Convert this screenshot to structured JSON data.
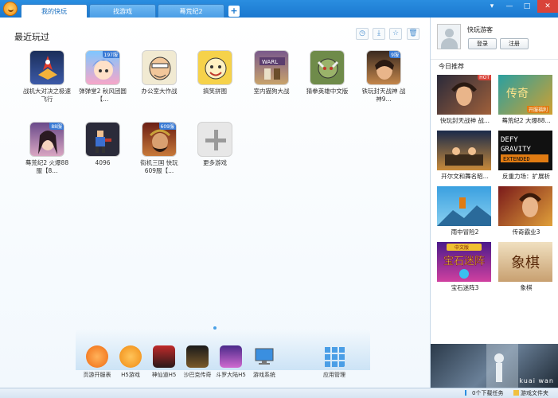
{
  "tabs": [
    {
      "label": "我的快玩",
      "active": true
    },
    {
      "label": "找游戏",
      "active": false
    },
    {
      "label": "蓦荒纪2",
      "active": false
    }
  ],
  "tab_add_label": "+",
  "window_controls": {
    "menu": "▾",
    "minimize": "—",
    "maximize": "□",
    "close": "✕"
  },
  "main": {
    "section_title": "最近玩过",
    "tools": [
      "clock-icon",
      "download-icon",
      "star-icon",
      "trash-icon"
    ],
    "games": [
      {
        "name": "战机大对决之极速飞行",
        "badge": ""
      },
      {
        "name": "弹弹堂2 秋风团圆【...",
        "badge": "197服"
      },
      {
        "name": "办公室大作战",
        "badge": ""
      },
      {
        "name": "搞笑拼图",
        "badge": ""
      },
      {
        "name": "室内猫狗大战",
        "badge": ""
      },
      {
        "name": "猜拳英雄中文版",
        "badge": ""
      },
      {
        "name": "铁玩封天战神 战神9...",
        "badge": "9服"
      },
      {
        "name": "蓦荒纪2 火爆88服【8...",
        "badge": "88服"
      },
      {
        "name": "4096",
        "badge": ""
      },
      {
        "name": "街机三国 快玩609服【...",
        "badge": "609服"
      },
      {
        "name": "更多游戏",
        "badge": ""
      }
    ]
  },
  "dock": [
    {
      "label": "页游开服表"
    },
    {
      "label": "H5游戏"
    },
    {
      "label": "神仙道H5"
    },
    {
      "label": "沙巴克传奇"
    },
    {
      "label": "斗罗大陆H5"
    },
    {
      "label": "游戏系统"
    },
    {
      "label": "应用管理"
    }
  ],
  "sidebar": {
    "username": "快玩游客",
    "login_label": "登录",
    "register_label": "注册",
    "today_title": "今日推荐",
    "recommend": [
      {
        "name": "快玩封天战神 战..."
      },
      {
        "name": "蓦荒纪2 大爆88..."
      },
      {
        "name": "开尔文和舞名昭..."
      },
      {
        "name": "反重力场：扩展析"
      },
      {
        "name": "雨中冒险2"
      },
      {
        "name": "传奇霸业3"
      },
      {
        "name": "宝石迷阵3"
      },
      {
        "name": "象棋"
      }
    ],
    "banner_text": "kuai wan",
    "recommend_text": {
      "defy": "DEFY",
      "gravity": "GRAVITY",
      "extended": "EXTENDED",
      "badge2": "开服福利",
      "badge1": "HOT",
      "gem_top": "中文版",
      "gem_main": "宝石迷阵",
      "chess": "象棋"
    }
  },
  "status": {
    "downloads": "0个下载任务",
    "folder": "游戏文件夹"
  }
}
